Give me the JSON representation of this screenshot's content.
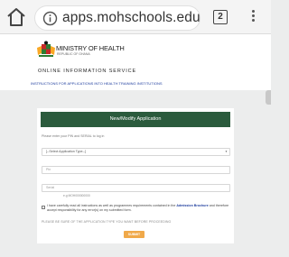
{
  "browser": {
    "url": "apps.mohschools.edu.gh",
    "tab_count": "2"
  },
  "header": {
    "ministry": "MINISTRY OF HEALTH",
    "ministry_sub": "REPUBLIC OF GHANA",
    "service": "ONLINE INFORMATION SERVICE",
    "instructions_link": "INSTRUCTIONS FOR APPLICATIONS INTO HEALTH TRAINING INSTITUTIONS"
  },
  "form": {
    "title": "New/Modify Application",
    "prompt": "Please enter your PIN and SERIAL to log in",
    "application_type": "[--Select Application Type--]",
    "pin_placeholder": "Pin",
    "serial_placeholder": "Serial",
    "serial_hint": "e.g MOH000000000",
    "agree_prefix": "I have carefully read all instructions as well as programmes requirements contained in the",
    "agree_link": "Admission Brochure",
    "agree_suffix": "and therefore accept responsibility for any error(s) on my submitted form.",
    "warning": "PLEASE BE SURE OF THE APPLICATION TYPE YOU WANT BEFORE PROCEEDING",
    "submit": "SUBMIT"
  },
  "colors": {
    "header_bar": "#2b5b3d",
    "submit_button": "#f0a94a",
    "link": "#1f3e9e"
  }
}
